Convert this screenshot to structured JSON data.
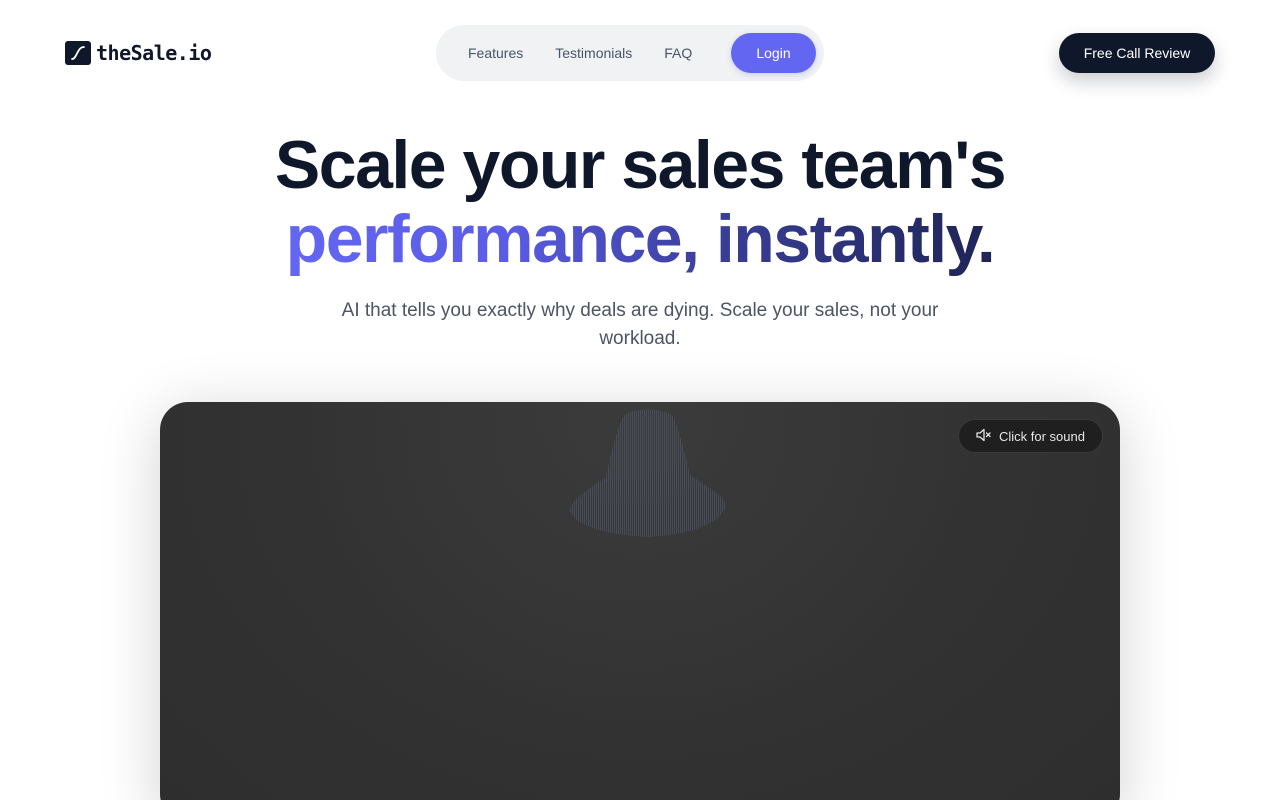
{
  "brand": {
    "name": "theSale.io",
    "icon": "logo-s-curve-icon",
    "color": "#0f172a"
  },
  "nav": {
    "links": [
      "Features",
      "Testimonials",
      "FAQ"
    ],
    "login_label": "Login",
    "accent": "#6366f1"
  },
  "cta": {
    "label": "Free Call Review"
  },
  "hero": {
    "headline_line1": "Scale your sales team's",
    "headline_line2": "performance, instantly.",
    "subtitle": "AI that tells you exactly why deals are dying. Scale your sales, not your workload."
  },
  "video": {
    "sound_label": "Click for sound",
    "sound_icon": "speaker-muted-icon"
  }
}
